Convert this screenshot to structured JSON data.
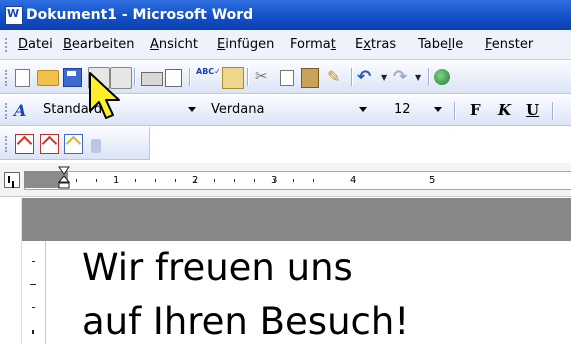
{
  "window": {
    "title": "Dokument1 - Microsoft Word"
  },
  "menu": {
    "items": [
      {
        "label": "Datei",
        "hotkey_index": 0
      },
      {
        "label": "Bearbeiten",
        "hotkey_index": 0
      },
      {
        "label": "Ansicht",
        "hotkey_index": 0
      },
      {
        "label": "Einfügen",
        "hotkey_index": 0
      },
      {
        "label": "Format",
        "hotkey_index": 5
      },
      {
        "label": "Extras",
        "hotkey_index": 1
      },
      {
        "label": "Tabelle",
        "hotkey_index": 4
      },
      {
        "label": "Fenster",
        "hotkey_index": 0
      }
    ]
  },
  "toolbar": {
    "icons": [
      "new-document-icon",
      "open-folder-icon",
      "save-icon",
      "permission-icon",
      "email-icon",
      "print-icon",
      "print-preview-icon",
      "spelling-icon",
      "research-icon",
      "cut-icon",
      "copy-icon",
      "paste-icon",
      "format-painter-icon",
      "undo-icon",
      "redo-icon",
      "hyperlink-icon"
    ]
  },
  "format_bar": {
    "style_value": "Standard",
    "font_value": "Verdana",
    "size_value": "12",
    "bold_label": "F",
    "italic_label": "K",
    "underline_label": "U"
  },
  "ruler": {
    "numbers": [
      "1",
      "2",
      "3",
      "4",
      "5"
    ]
  },
  "document": {
    "lines": [
      "Wir freuen uns",
      "auf Ihren Besuch!"
    ]
  }
}
